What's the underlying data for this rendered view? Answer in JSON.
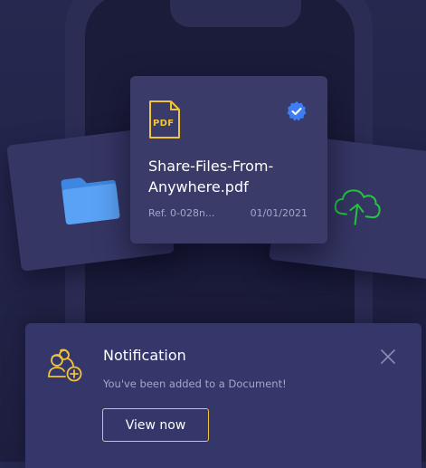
{
  "file_card": {
    "type_badge": "PDF",
    "name": "Share-Files-From-Anywhere.pdf",
    "reference": "Ref. 0-028n...",
    "date": "01/01/2021",
    "verified_icon": "verified-check-icon"
  },
  "side_cards": {
    "left_icon": "folder-icon",
    "right_icon": "cloud-upload-icon"
  },
  "notification": {
    "icon": "add-user-icon",
    "title": "Notification",
    "message": "You've been added to a Document!",
    "button_label": "View now",
    "close_icon": "close-icon"
  },
  "colors": {
    "background": "#24264c",
    "card": "#3a3b69",
    "accent_yellow": "#f0c43b",
    "accent_green": "#25c73f",
    "verified_blue": "#3d7ef2",
    "folder_blue": "#4a95f0",
    "muted_text": "#a4a6c9"
  }
}
